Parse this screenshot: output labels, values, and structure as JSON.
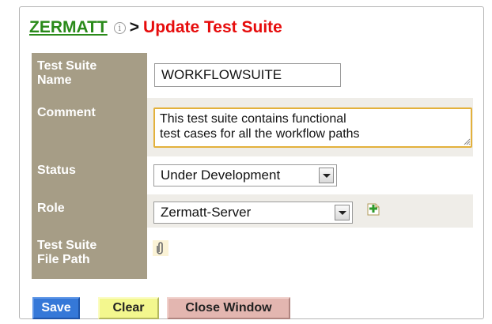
{
  "header": {
    "app_name": "ZERMATT",
    "separator": ">",
    "page_title": "Update Test Suite",
    "info_glyph": "i"
  },
  "form": {
    "name": {
      "label_line1": "Test Suite",
      "label_line2": "Name",
      "value": "WORKFLOWSUITE"
    },
    "comment": {
      "label": "Comment",
      "value": "This test suite contains functional\ntest cases for all the workflow paths"
    },
    "status": {
      "label": "Status",
      "selected": "Under Development"
    },
    "role": {
      "label": "Role",
      "selected": "Zermatt-Server"
    },
    "file_path": {
      "label_line1": "Test Suite",
      "label_line2": "File Path"
    }
  },
  "buttons": {
    "save": "Save",
    "clear": "Clear",
    "close_window": "Close Window"
  },
  "colors": {
    "label_column": "#a69d86",
    "app_name": "#2a8a1a",
    "page_title": "#e60c0c",
    "save_button": "#3578d8",
    "clear_button": "#f3f78e",
    "close_button": "#e3b6b0",
    "focus_border": "#e3b13c"
  },
  "icons": {
    "info": "info-icon",
    "add": "add-role-icon",
    "attach": "paperclip-icon"
  }
}
